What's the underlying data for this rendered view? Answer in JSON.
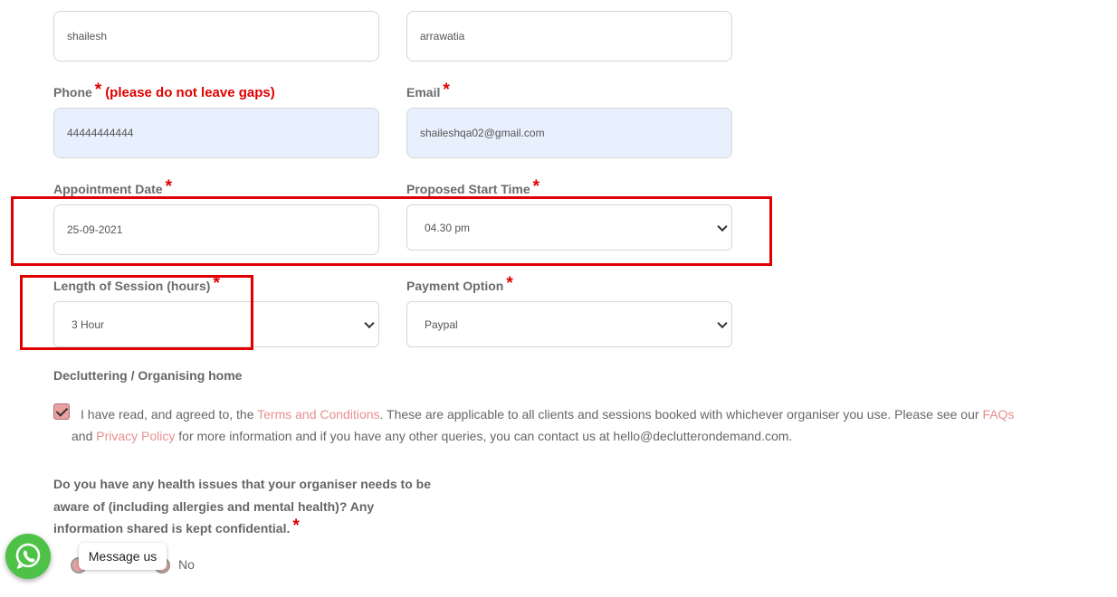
{
  "name": {
    "first_value": "shailesh",
    "last_value": "arrawatia"
  },
  "phone": {
    "label": "Phone",
    "required_mark": "*",
    "note": "(please do not leave gaps)",
    "value": "44444444444"
  },
  "email": {
    "label": "Email",
    "required_mark": "*",
    "value": "shaileshqa02@gmail.com"
  },
  "appointment_date": {
    "label": "Appointment Date",
    "required_mark": "*",
    "value": "25-09-2021"
  },
  "start_time": {
    "label": "Proposed Start Time",
    "required_mark": "*",
    "selected": "04.30 pm"
  },
  "session_length": {
    "label": "Length of Session (hours)",
    "required_mark": "*",
    "selected": "3 Hour"
  },
  "payment": {
    "label": "Payment Option",
    "required_mark": "*",
    "selected": "Paypal"
  },
  "service": {
    "title": "Decluttering / Organising home"
  },
  "terms": {
    "text1": "I have read, and agreed to, the ",
    "terms_link": "Terms and Conditions",
    "text2": ". These are applicable to all clients and sessions booked with whichever organiser you use. Please see our ",
    "faqs_link": "FAQs",
    "text3": "and ",
    "privacy_link": "Privacy Policy",
    "text4": " for more information and if you have any other queries, you can contact us at hello@declutterondemand.com."
  },
  "health": {
    "line1": "Do you have any health issues that your organiser needs to be",
    "line2": "aware of (including allergies and mental health)? Any",
    "line3": "information shared is kept confidential.",
    "required_mark": "*",
    "option_no": "No"
  },
  "whatsapp": {
    "label": "Message us",
    "icon": "whatsapp-icon",
    "color": "#4dc247"
  },
  "highlight_color": "#e00000"
}
